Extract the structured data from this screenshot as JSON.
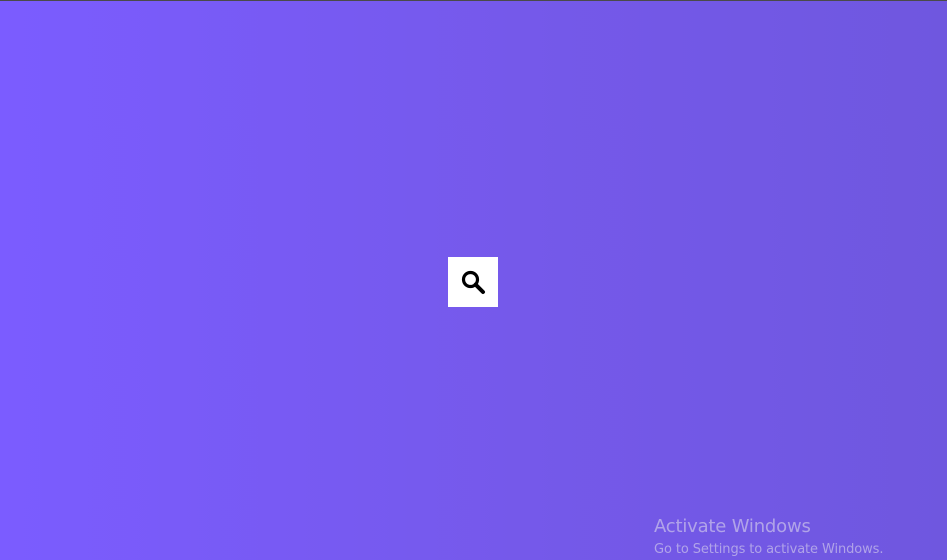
{
  "background": {
    "gradient_start": "#7b5cff",
    "gradient_end": "#6f57df"
  },
  "search_button": {
    "icon": "search-icon",
    "background": "#ffffff"
  },
  "watermark": {
    "title": "Activate Windows",
    "subtitle": "Go to Settings to activate Windows."
  }
}
